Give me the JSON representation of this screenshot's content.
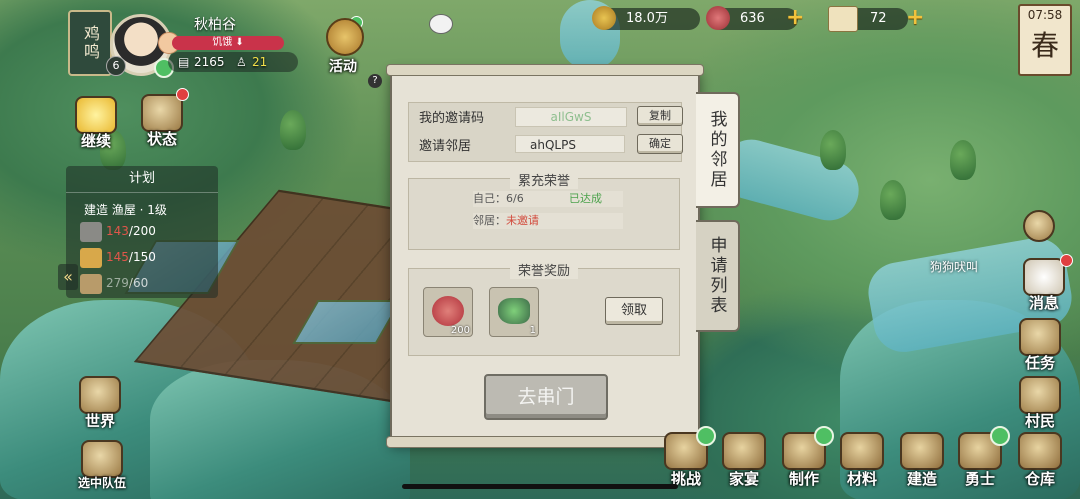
{
  "player": {
    "name_vertical": "鸡鸣",
    "level": "6",
    "name": "秋柏谷",
    "status": "饥饿",
    "coins": "2165",
    "stat2": "21"
  },
  "activity": {
    "label": "活动"
  },
  "resources": [
    {
      "icon": "copper-coin-icon",
      "value": "18.0万",
      "color": "#c89a2a"
    },
    {
      "icon": "red-gem-icon",
      "value": "636",
      "color": "#c44a4a"
    },
    {
      "icon": "ticket-icon",
      "value": "72",
      "color": "#e9dcb3"
    }
  ],
  "clock": {
    "time": "07:58",
    "season": "春"
  },
  "left_menu": {
    "continue": "继续",
    "status": "状态",
    "world": "世界",
    "team": "选中队伍"
  },
  "plan": {
    "title": "计划",
    "task": "建造 渔屋 · 1级",
    "rows": [
      {
        "current": "143",
        "total": "/200",
        "done": false
      },
      {
        "current": "145",
        "total": "/150",
        "done": false
      },
      {
        "current": "279",
        "total": "/60",
        "done": true
      }
    ]
  },
  "modal": {
    "my_code_label": "我的邀请码",
    "my_code": "aIlGwS",
    "copy": "复制",
    "invite_label": "邀请邻居",
    "invite_value": "ahQLPS",
    "confirm": "确定",
    "honor_title": "累充荣誉",
    "self_progress": "自己：6/6",
    "self_status": "已达成",
    "neighbor_label": "邻居：",
    "neighbor_status": "未邀请",
    "reward_title": "荣誉奖励",
    "rewards": [
      {
        "icon": "red-seal-icon",
        "count": "200"
      },
      {
        "icon": "jade-ore-icon",
        "count": "1"
      }
    ],
    "claim": "领取",
    "go_button": "去串门"
  },
  "tabs": {
    "neighbors": "我的邻居",
    "requests": "申请列表"
  },
  "right_menu": {
    "message": "消息",
    "quest": "任务",
    "villager": "村民"
  },
  "sign_text": "狗狗吠叫",
  "bottom": [
    "挑战",
    "家宴",
    "制作",
    "材料",
    "建造",
    "勇士",
    "仓库"
  ]
}
